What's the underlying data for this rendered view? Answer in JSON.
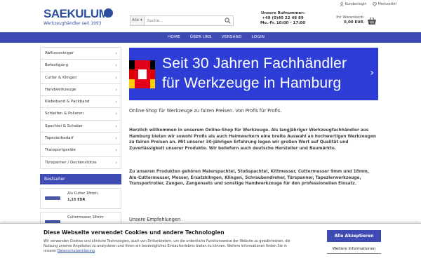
{
  "header": {
    "logo_text": "SAEKULUM",
    "logo_sub": "Werkzeughändler seit 1993",
    "search": {
      "category": "Alle",
      "placeholder": "Suche..."
    },
    "hotline": {
      "title": "Unsere Rufnummer:",
      "number": "+49 (0)40 22 48 89",
      "hours": "Mo.-Fr. 10:00 - 17:00"
    },
    "top_links": {
      "login": "Kundenlogin",
      "wishlist": "Merkzettel"
    },
    "cart": {
      "label": "Ihr Warenkorb",
      "total": "0,00 EUR"
    }
  },
  "nav": {
    "items": [
      "HOME",
      "ÜBER UNS",
      "VERSAND",
      "LOGIN"
    ]
  },
  "sidebar": {
    "categories": [
      "Abflussreiniger",
      "Befestigung",
      "Cutter & Klingen",
      "Handwerkzeuge",
      "Klebeband & Packband",
      "Schleifen & Polieren",
      "Spachtel & Schaber",
      "Tapezierbedarf",
      "Transportgeräte",
      "Türspanner / Deckenstütze"
    ],
    "bestseller_title": "Bestseller",
    "bestsellers": [
      {
        "name": "Alu Cutter 18mm",
        "price": "1,15 EUR"
      },
      {
        "name": "Cuttermesser 18mm",
        "price": ""
      }
    ]
  },
  "banner": {
    "line1": "Seit 30 Jahren Fachhändler",
    "line2": "für Werkzeuge in Hamburg"
  },
  "main": {
    "tagline": "Online-Shop für Werkzeuge zu fairen Preisen. Von Profis für Profis.",
    "welcome": "Herzlich willkommen in unserem Online-Shop für Werkzeuge. Als langjähriger Werkzeugfachhändler aus Hamburg bieten wir sowohl Profis als auch Heimwerkern eine breite Auswahl an hochwertigen Werkzeugen zu fairen Preisen an. Mit unserer 30-jährigen Erfahrung legen wir großen Wert auf Qualität und Zuverlässigkeit unserer Produkte. Wir beliefern auch deutsche Hersteller und Baumärkte.",
    "products": "Zu unseren Produkten gehören Malerspachtel, Stoßspachtel, Kittmesser,  Cuttermesser 9mm und 18mm, Alu-Cuttermesser, Messer, Ersatzklingen, Klingen, Schraubendreher, Türspanner, Tapezierwerkzeuge, Transportroller, Zangen, Zangensets und sonstige Handwerkzeuge für den professionellen Einsatz.",
    "empfehlungen": "Unsere Empfehlungen"
  },
  "cookie": {
    "title": "Diese Webseite verwendet Cookies und andere Technologien",
    "text": "Wir verwenden Cookies und ähnliche Technologien, auch von Drittanbietern, um die ordentliche Funktionsweise der Website zu gewährleisten, die Nutzung unseres Angebotes zu analysieren und Ihnen ein bestmögliches Einkaufserlebnis bieten zu können. Weitere Informationen finden Sie in unserer",
    "link": "Datenschutzerklärung",
    "accept": "Alle Akzeptieren",
    "more": "Weitere Informationen"
  },
  "colors": {
    "brand": "#2b4f9e",
    "nav": "#3d4bb3",
    "banner": "#2d3dd5"
  }
}
